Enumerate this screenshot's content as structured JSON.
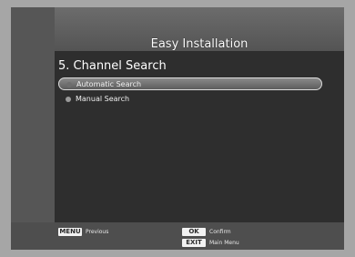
{
  "header": {
    "title": "Easy Installation"
  },
  "section": {
    "title": "5. Channel Search"
  },
  "menu": {
    "items": [
      {
        "label": "Automatic Search"
      },
      {
        "label": "Manual Search"
      }
    ]
  },
  "footer": {
    "menu_key": "MENU",
    "menu_desc": "Previous",
    "ok_key": "OK",
    "ok_desc": "Confirm",
    "exit_key": "EXIT",
    "exit_desc": "Main Menu"
  }
}
